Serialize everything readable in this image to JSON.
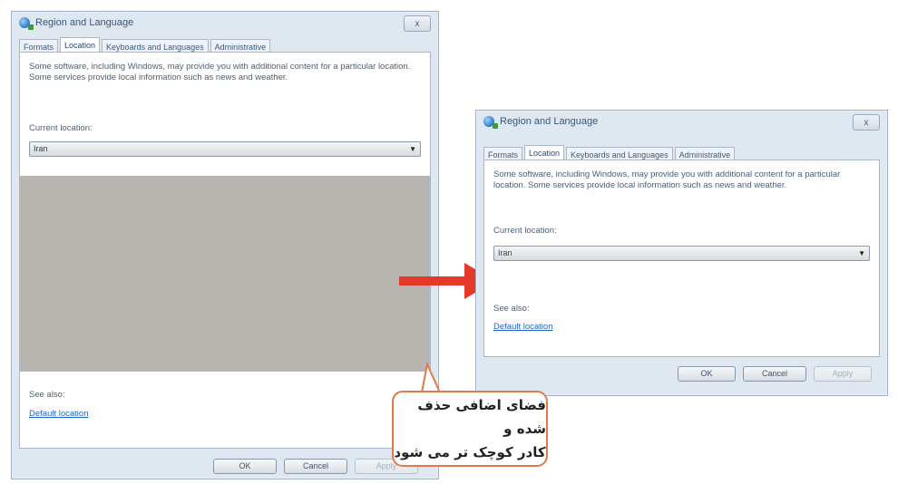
{
  "left_dialog": {
    "title": "Region and Language",
    "close": "x",
    "tabs": [
      "Formats",
      "Location",
      "Keyboards and Languages",
      "Administrative"
    ],
    "description": "Some software, including Windows, may provide you with additional content for a particular location. Some services provide local information such as news and weather.",
    "current_location_label": "Current location:",
    "current_location_value": "Iran",
    "see_also_label": "See also:",
    "default_location_link": "Default location",
    "buttons": {
      "ok": "OK",
      "cancel": "Cancel",
      "apply": "Apply"
    }
  },
  "right_dialog": {
    "title": "Region and Language",
    "close": "x",
    "tabs": [
      "Formats",
      "Location",
      "Keyboards and Languages",
      "Administrative"
    ],
    "description": "Some software, including Windows, may provide you with additional content for a particular location. Some services provide local information such as news and weather.",
    "current_location_label": "Current location:",
    "current_location_value": "Iran",
    "see_also_label": "See also:",
    "default_location_link": "Default location",
    "buttons": {
      "ok": "OK",
      "cancel": "Cancel",
      "apply": "Apply"
    }
  },
  "combo_arrow": "▼",
  "callout": {
    "line1": "فضای اضافی حذف شده و",
    "line2": "کادر کوچک تر می شود"
  },
  "colors": {
    "arrow": "#e53a2a",
    "callout_border": "#e07a4a",
    "link": "#1e64c8"
  }
}
